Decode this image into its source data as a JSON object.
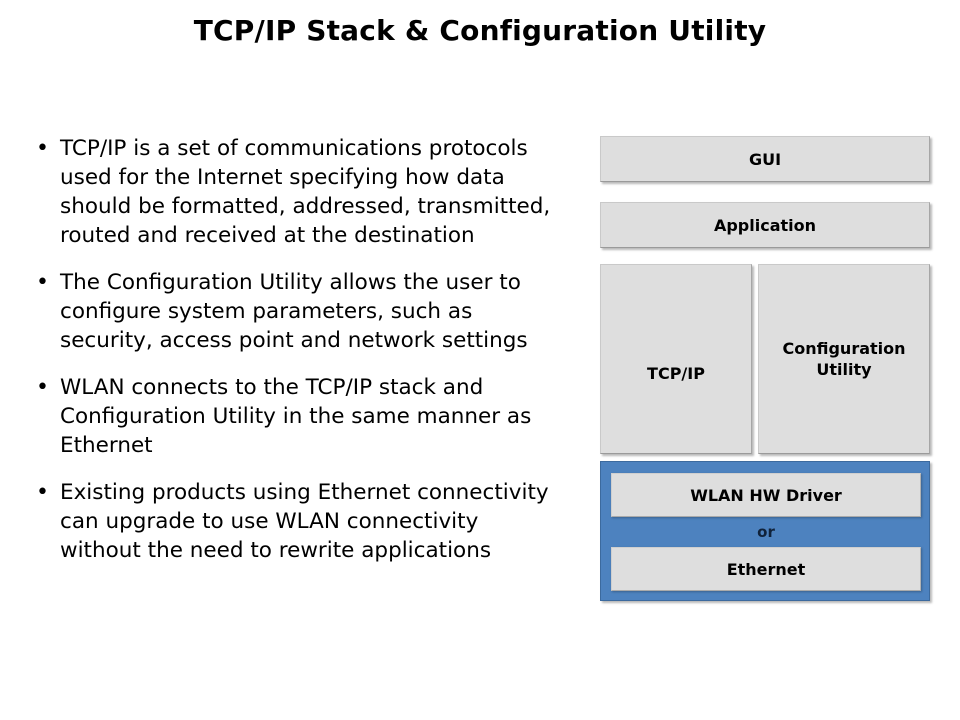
{
  "slide": {
    "title": "TCP/IP Stack & Configuration Utility",
    "bullet_marker": "•"
  },
  "bullets": [
    {
      "text": "TCP/IP is a set of communications protocols used for the Internet specifying how data should be formatted, addressed, transmitted, routed and received at the destination"
    },
    {
      "text": "The Configuration Utility allows the user to configure system parameters, such as security, access point and network settings"
    },
    {
      "text": "WLAN connects to the TCP/IP stack and Configuration Utility in the same manner as Ethernet"
    },
    {
      "text": "Existing products using Ethernet connectivity can upgrade to use WLAN connectivity without the need to rewrite applications"
    }
  ],
  "diagram": {
    "gui": "GUI",
    "application": "Application",
    "tcpip": "TCP/IP",
    "config_utility": "Configuration\nUtility",
    "config_utility_line1": "Configuration",
    "config_utility_line2": "Utility",
    "wlan_hw_driver": "WLAN HW Driver",
    "separator": "or",
    "ethernet": "Ethernet"
  },
  "colors": {
    "block_fill": "#dedede",
    "hw_container": "#4d82bf",
    "text": "#000000",
    "background": "#ffffff",
    "separator_text": "#10223a"
  }
}
